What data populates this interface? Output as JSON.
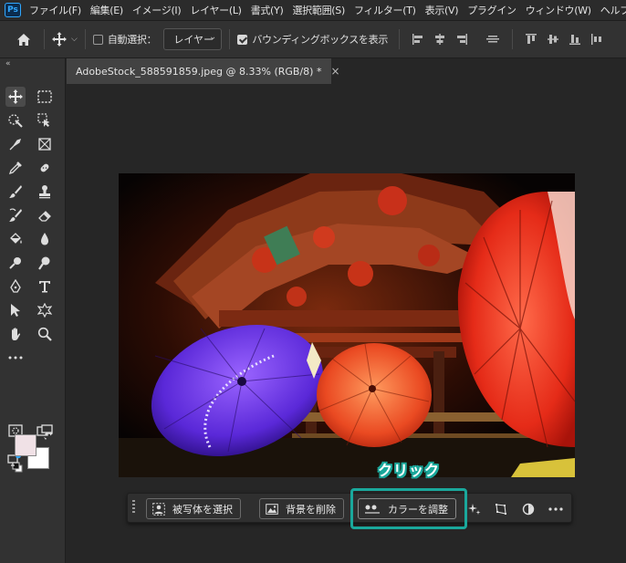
{
  "app": {
    "logo_text": "Ps"
  },
  "menu": {
    "items": [
      "ファイル(F)",
      "編集(E)",
      "イメージ(I)",
      "レイヤー(L)",
      "書式(Y)",
      "選択範囲(S)",
      "フィルター(T)",
      "表示(V)",
      "プラグイン",
      "ウィンドウ(W)",
      "ヘルプ(H)"
    ]
  },
  "options": {
    "auto_select_label": "自動選択：",
    "auto_select_checked": false,
    "layer_dropdown": "レイヤー",
    "bounding_box_label": "バウンディングボックスを表示",
    "bounding_box_checked": true
  },
  "toolbar": {
    "collapse": "«"
  },
  "document": {
    "tab_title": "AdobeStock_588591859.jpeg @ 8.33% (RGB/8) *",
    "close_glyph": "×"
  },
  "callout": {
    "label": "クリック",
    "color": "#1aa89c"
  },
  "taskbar": {
    "select_subject": "被写体を選択",
    "remove_background": "背景を削除",
    "adjust_color": "カラーを調整"
  },
  "colors": {
    "foreground": "#f0e1e6",
    "background": "#ffffff",
    "accent": "#31a8ff"
  }
}
